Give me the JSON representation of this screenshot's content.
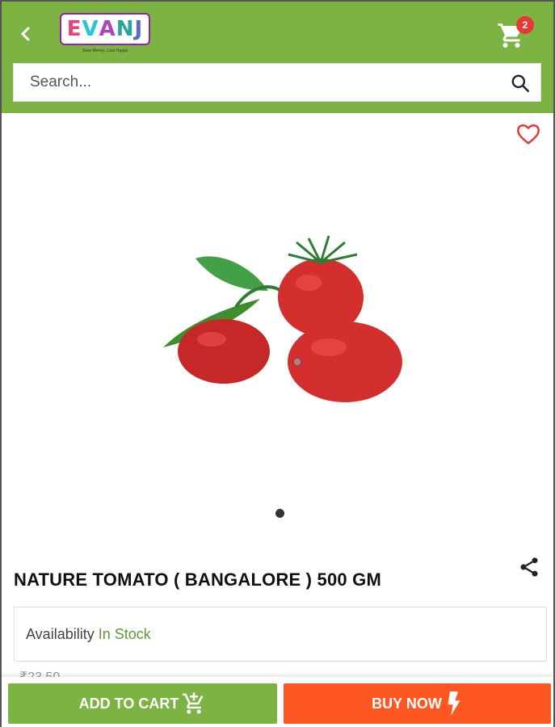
{
  "header": {
    "logo": {
      "text": "EVANJ",
      "tagline": "Save Money...Live Happy"
    },
    "cart_count": "2",
    "colors": {
      "primary": "#7cb342",
      "badge": "#e53935"
    }
  },
  "search": {
    "placeholder": "Search..."
  },
  "product": {
    "title": "NATURE TOMATO ( BANGALORE ) 500 GM",
    "availability_label": "Availability",
    "availability_value": "In Stock",
    "price": "₹23.50",
    "image_icon": "tomatoes-image"
  },
  "actions": {
    "add_to_cart": "ADD TO CART",
    "buy_now": "BUY NOW",
    "colors": {
      "add_to_cart": "#7cb342",
      "buy_now": "#ff5722"
    }
  }
}
